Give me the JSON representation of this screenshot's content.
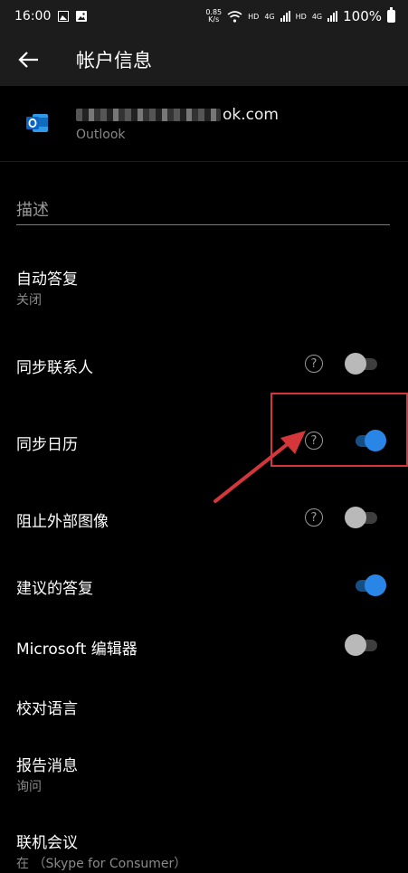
{
  "status_bar": {
    "time": "16:00",
    "net_speed_value": "0.85",
    "net_speed_unit": "K/s",
    "hd1": "HD",
    "sig1": "4G",
    "hd2": "HD",
    "sig2": "4G",
    "battery": "100%",
    "icons": [
      "image-icon",
      "gallery-icon",
      "wifi-icon",
      "signal-icon",
      "battery-icon"
    ]
  },
  "header": {
    "title": "帐户信息",
    "back_icon": "back-arrow-icon"
  },
  "account": {
    "email_visible": "ok.com",
    "type": "Outlook",
    "icon": "outlook-icon",
    "brand_color": "#0a64c8"
  },
  "description": {
    "placeholder": "描述"
  },
  "settings": {
    "auto_reply": {
      "label": "自动答复",
      "value": "关闭"
    },
    "sync_contacts": {
      "label": "同步联系人",
      "enabled": false
    },
    "sync_calendar": {
      "label": "同步日历",
      "enabled": true
    },
    "block_external_images": {
      "label": "阻止外部图像",
      "enabled": false
    },
    "suggested_replies": {
      "label": "建议的答复",
      "enabled": true
    },
    "editor": {
      "label": "Microsoft 编辑器",
      "enabled": false
    },
    "proofing_language": {
      "label": "校对语言"
    },
    "report_message": {
      "label": "报告消息",
      "value": "询问"
    },
    "online_meeting": {
      "label": "联机会议",
      "value": "在 （Skype for Consumer）"
    },
    "help_icon": "?"
  },
  "colors": {
    "toggle_on": "#2a86e6",
    "annotation": "#d4363a"
  }
}
